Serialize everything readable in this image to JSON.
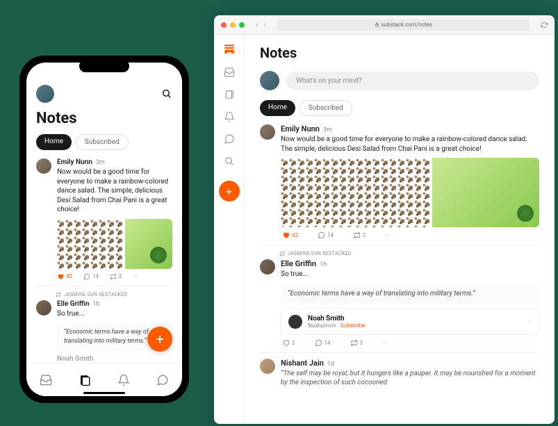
{
  "page_title": "Notes",
  "tabs": {
    "home": "Home",
    "subscribed": "Subscribed"
  },
  "compose_placeholder": "What's on your mind?",
  "browser": {
    "url": "substack.com/notes"
  },
  "posts": {
    "emily": {
      "author": "Emily Nunn",
      "time": "3m",
      "text": "Now would be a good time for everyone to make a rainbow-colored dance salad. The simple, delicious Desi Salad from Chai Pani is a great choice!",
      "likes": "42",
      "comments": "14",
      "restacks": "2"
    },
    "restack_label": "JASMINE SUN RESTACKED",
    "elle": {
      "author": "Elle Griffin",
      "time": "1h",
      "text": "So true...",
      "quote": "“Economic terms have a way of translating into military terms.”",
      "quoted_author": "Noah Smith",
      "quoted_pub": "Noahpinion",
      "subscribe": "Subscribe",
      "likes": "2",
      "comments": "14",
      "restacks": "3"
    },
    "noah_smith_mobile": "Noah Smith",
    "nishant": {
      "author": "Nishant Jain",
      "time": "1d",
      "text": "“The self may be royal, but it hungers like a pauper. It may be nourished for a moment by the inspection of such cocooned"
    }
  },
  "more_glyph": "···"
}
